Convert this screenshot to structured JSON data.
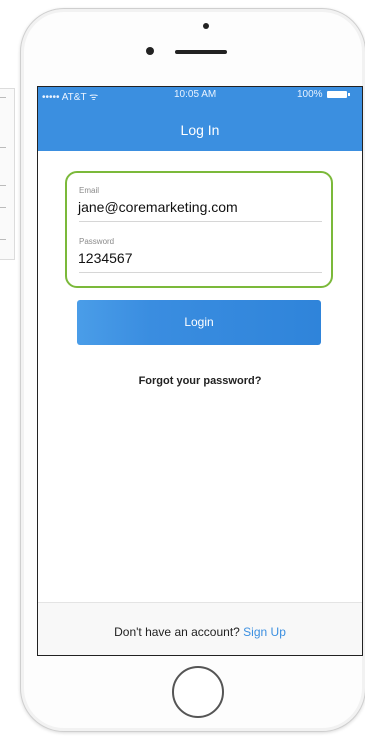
{
  "status_bar": {
    "carrier": "••••• AT&T ᯤ",
    "time": "10:05 AM",
    "battery": "100%"
  },
  "navbar": {
    "title": "Log In"
  },
  "form": {
    "email_label": "Email",
    "email_value": "jane@coremarketing.com",
    "password_label": "Password",
    "password_value": "1234567"
  },
  "login_button": "Login",
  "forgot_link": "Forgot your password?",
  "footer": {
    "prompt": "Don't have an account?",
    "signup_link": "Sign Up"
  },
  "colors": {
    "accent": "#3b8fe0",
    "highlight_border": "#7bb93a"
  }
}
